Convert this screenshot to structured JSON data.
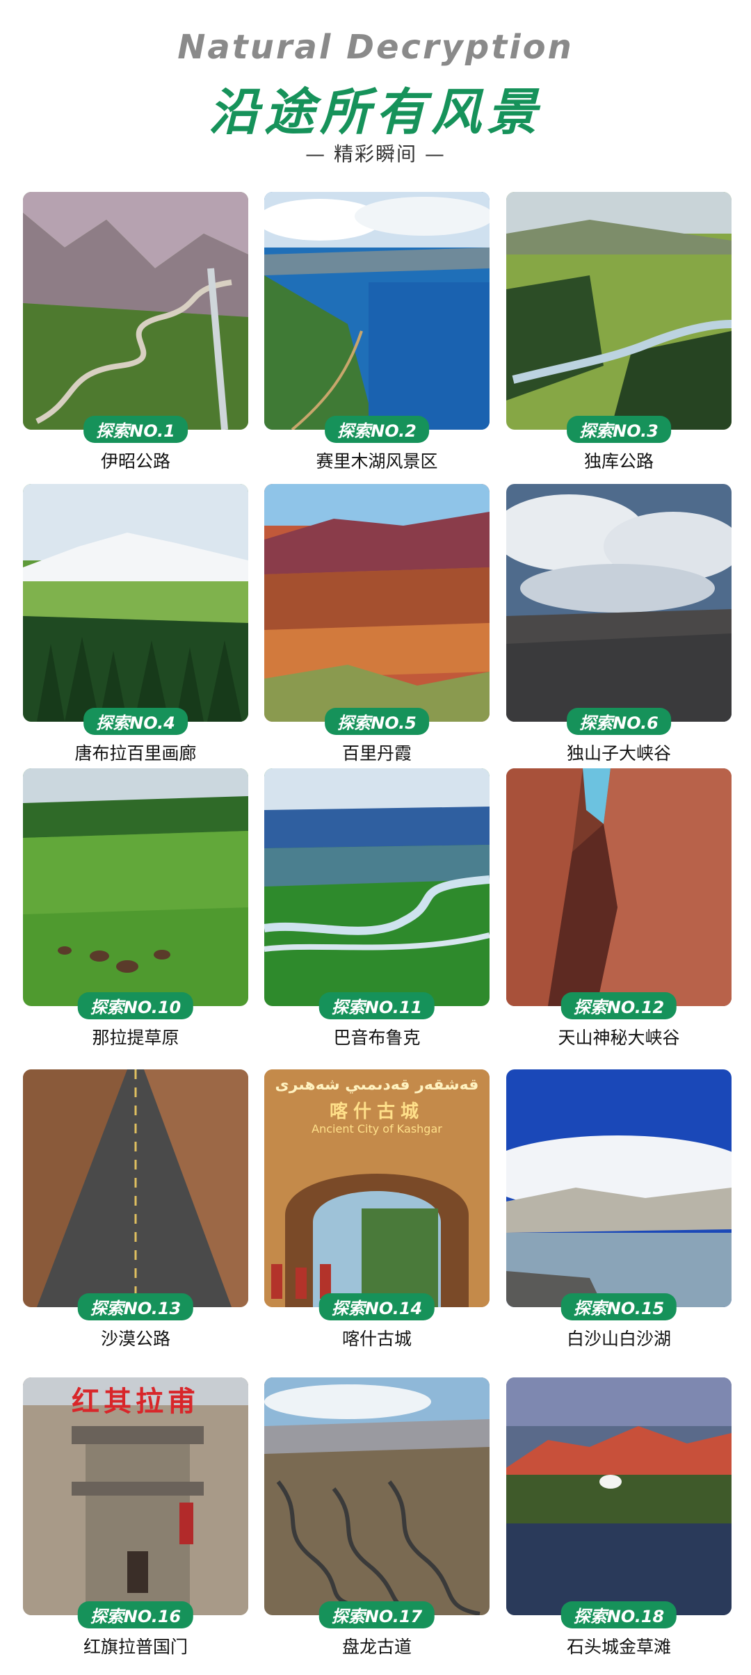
{
  "header": {
    "en_title": "Natural Decryption",
    "cn_title": "沿途所有风景",
    "subtitle": "— 精彩瞬间 —"
  },
  "spots": [
    {
      "badge": "探索NO.1",
      "name": "伊昭公路"
    },
    {
      "badge": "探索NO.2",
      "name": "赛里木湖风景区"
    },
    {
      "badge": "探索NO.3",
      "name": "独库公路"
    },
    {
      "badge": "探索NO.4",
      "name": "唐布拉百里画廊"
    },
    {
      "badge": "探索NO.5",
      "name": "百里丹霞"
    },
    {
      "badge": "探索NO.6",
      "name": "独山子大峡谷"
    },
    {
      "badge": "探索NO.10",
      "name": "那拉提草原"
    },
    {
      "badge": "探索NO.11",
      "name": "巴音布鲁克"
    },
    {
      "badge": "探索NO.12",
      "name": "天山神秘大峡谷"
    },
    {
      "badge": "探索NO.13",
      "name": "沙漠公路"
    },
    {
      "badge": "探索NO.14",
      "name": "喀什古城"
    },
    {
      "badge": "探索NO.15",
      "name": "白沙山白沙湖"
    },
    {
      "badge": "探索NO.16",
      "name": "红旗拉普国门"
    },
    {
      "badge": "探索NO.17",
      "name": "盘龙古道"
    },
    {
      "badge": "探索NO.18",
      "name": "石头城金草滩"
    }
  ],
  "photo_text": {
    "kashgar_uyghur": "قەشقەر قەدىمىي شەھىرى",
    "kashgar_cn": "喀什古城",
    "kashgar_en": "Ancient City of Kashgar",
    "hongqi_sign": "红其拉甫"
  },
  "colors": {
    "accent": "#16925a",
    "en_title": "#8a8a8a"
  }
}
